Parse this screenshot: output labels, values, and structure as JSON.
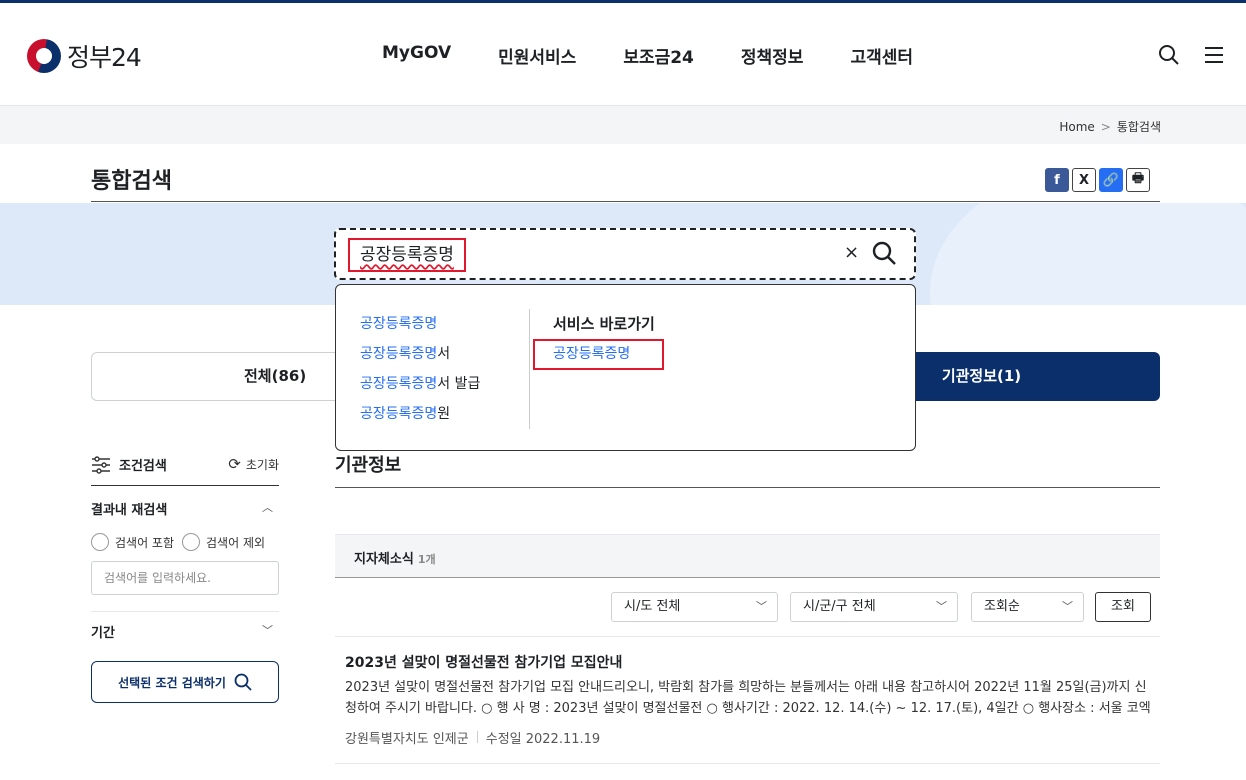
{
  "header": {
    "logo_text": "정부24",
    "nav": [
      "MyGOV",
      "민원서비스",
      "보조금24",
      "정책정보",
      "고객센터"
    ],
    "icons": [
      "search-icon",
      "menu-icon"
    ]
  },
  "breadcrumb": {
    "home": "Home",
    "sep": ">",
    "current": "통합검색"
  },
  "page": {
    "title": "통합검색"
  },
  "share": {
    "facebook": "f",
    "x": "X",
    "link": "🔗",
    "print": "🖶"
  },
  "search": {
    "value": "공장등록증명",
    "clear": "×"
  },
  "autocomplete": {
    "suggestions": [
      {
        "hl": "공장등록증명",
        "rest": ""
      },
      {
        "hl": "공장등록증명",
        "rest": "서"
      },
      {
        "hl": "공장등록증명",
        "rest": "서 발급"
      },
      {
        "hl": "공장등록증명",
        "rest": "원"
      }
    ],
    "service_title": "서비스 바로가기",
    "service_link": "공장등록증명"
  },
  "tabs": {
    "all": "전체(86)",
    "org": "기관정보(1)"
  },
  "filter": {
    "title": "조건검색",
    "reset": "초기화",
    "research_title": "결과내 재검색",
    "include": "검색어 포함",
    "exclude": "검색어 제외",
    "placeholder": "검색어를 입력하세요.",
    "period": "기간",
    "submit": "선택된 조건 검색하기"
  },
  "section": {
    "title": "기관정보",
    "subtab": "지자체소식",
    "subtab_count": "1개"
  },
  "selects": {
    "sido": "시/도 전체",
    "sigungu": "시/군/구 전체",
    "order": "조회순",
    "search_btn": "조회"
  },
  "result": {
    "title": "2023년 설맞이 명절선물전 참가기업 모집안내",
    "desc": "2023년 설맞이 명절선물전 참가기업 모집 안내드리오니, 박람회 참가를 희망하는 분들께서는 아래 내용 참고하시어 2022년 11월 25일(금)까지 신청하여 주시기 바랍니다. ○ 행 사 명 : 2023년 설맞이 명절선물전 ○ 행사기간 : 2022. 12. 14.(수) ~ 12. 17.(토), 4일간 ○ 행사장소 : 서울 코엑스…",
    "org": "강원특별자치도 인제군",
    "date": "수정일 2022.11.19"
  }
}
